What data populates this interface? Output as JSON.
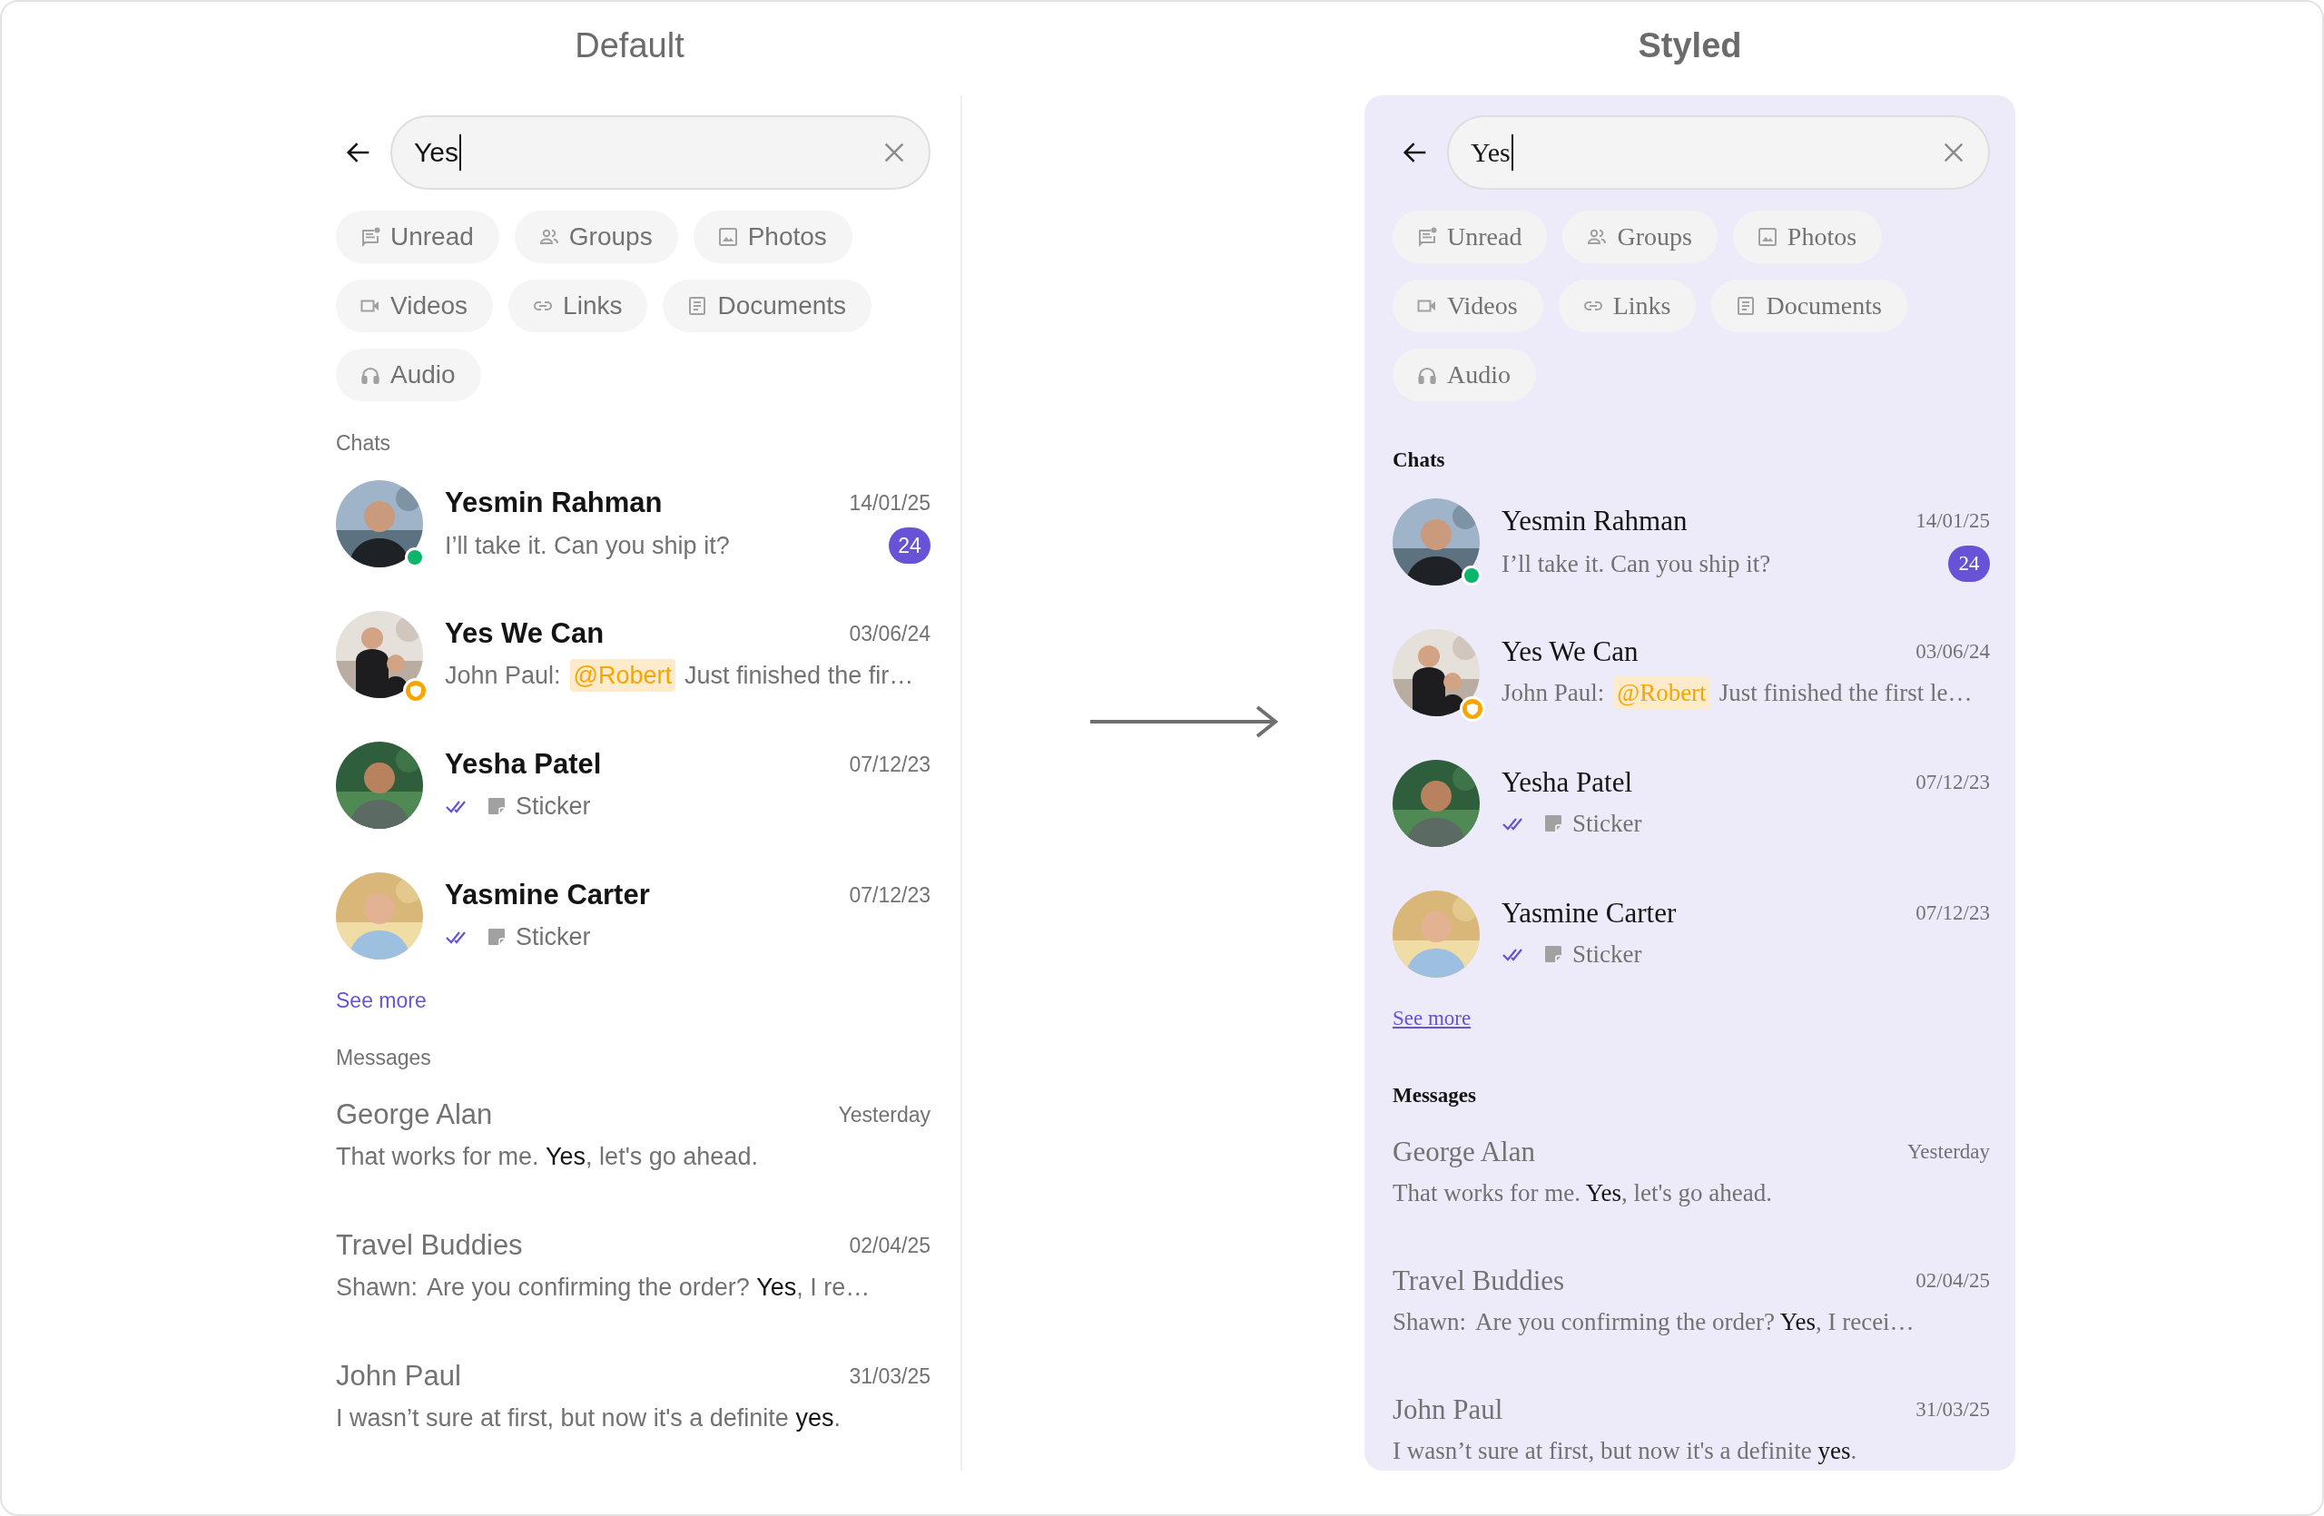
{
  "panels": [
    {
      "kind": "default",
      "title": "Default",
      "search": {
        "value": "Yes"
      },
      "filters": [
        {
          "kind": "unread",
          "label": "Unread"
        },
        {
          "kind": "groups",
          "label": "Groups"
        },
        {
          "kind": "photos",
          "label": "Photos"
        },
        {
          "kind": "videos",
          "label": "Videos"
        },
        {
          "kind": "links",
          "label": "Links"
        },
        {
          "kind": "documents",
          "label": "Documents"
        },
        {
          "kind": "audio",
          "label": "Audio"
        }
      ],
      "chats": {
        "label": "Chats",
        "rows": [
          {
            "name": "Yesmin Rahman",
            "date": "14/01/25",
            "online": true,
            "protected": false,
            "unread": "24",
            "preview": {
              "kind": "text",
              "text": "I’ll take it. Can you ship it?"
            }
          },
          {
            "name": "Yes We Can",
            "date": "03/06/24",
            "online": false,
            "protected": true,
            "preview": {
              "kind": "mention",
              "sender": "John Paul:",
              "mention": "@Robert",
              "text": "Just finished the fir…"
            }
          },
          {
            "name": "Yesha Patel",
            "date": "07/12/23",
            "online": false,
            "protected": false,
            "preview": {
              "kind": "sticker",
              "read": true,
              "text": "Sticker"
            }
          },
          {
            "name": "Yasmine Carter",
            "date": "07/12/23",
            "online": false,
            "protected": false,
            "preview": {
              "kind": "sticker",
              "read": true,
              "text": "Sticker"
            }
          }
        ],
        "see_more": "See more"
      },
      "messages": {
        "label": "Messages",
        "rows": [
          {
            "name": "George Alan",
            "date": "Yesterday",
            "text": "That works for me. **Yes**, let's go ahead."
          },
          {
            "name": "Travel Buddies",
            "date": "02/04/25",
            "sender": "Shawn:",
            "text": "Are you confirming the order? **Yes**, I re…"
          },
          {
            "name": "John Paul",
            "date": "31/03/25",
            "text": "I wasn’t sure at first, but now it's a definite **yes**."
          }
        ]
      }
    },
    {
      "kind": "styled",
      "title": "Styled",
      "search": {
        "value": "Yes"
      },
      "filters": [
        {
          "kind": "unread",
          "label": "Unread"
        },
        {
          "kind": "groups",
          "label": "Groups"
        },
        {
          "kind": "photos",
          "label": "Photos"
        },
        {
          "kind": "videos",
          "label": "Videos"
        },
        {
          "kind": "links",
          "label": "Links"
        },
        {
          "kind": "documents",
          "label": "Documents"
        },
        {
          "kind": "audio",
          "label": "Audio"
        }
      ],
      "chats": {
        "label": "Chats",
        "rows": [
          {
            "name": "Yesmin Rahman",
            "date": "14/01/25",
            "online": true,
            "protected": false,
            "unread": "24",
            "preview": {
              "kind": "text",
              "text": "I’ll take it. Can you ship it?"
            }
          },
          {
            "name": "Yes We Can",
            "date": "03/06/24",
            "online": false,
            "protected": true,
            "preview": {
              "kind": "mention",
              "sender": "John Paul:",
              "mention": "@Robert",
              "text": "Just finished the first le…"
            }
          },
          {
            "name": "Yesha Patel",
            "date": "07/12/23",
            "online": false,
            "protected": false,
            "preview": {
              "kind": "sticker",
              "read": true,
              "text": "Sticker"
            }
          },
          {
            "name": "Yasmine Carter",
            "date": "07/12/23",
            "online": false,
            "protected": false,
            "preview": {
              "kind": "sticker",
              "read": true,
              "text": "Sticker"
            }
          }
        ],
        "see_more": "See more"
      },
      "messages": {
        "label": "Messages",
        "rows": [
          {
            "name": "George Alan",
            "date": "Yesterday",
            "text": "That works for me. **Yes**, let's go ahead."
          },
          {
            "name": "Travel Buddies",
            "date": "02/04/25",
            "sender": "Shawn:",
            "text": "Are you confirming the order? **Yes**, I recei…"
          },
          {
            "name": "John Paul",
            "date": "31/03/25",
            "text": "I wasn’t sure at first, but now it's a definite **yes**."
          }
        ]
      }
    }
  ]
}
